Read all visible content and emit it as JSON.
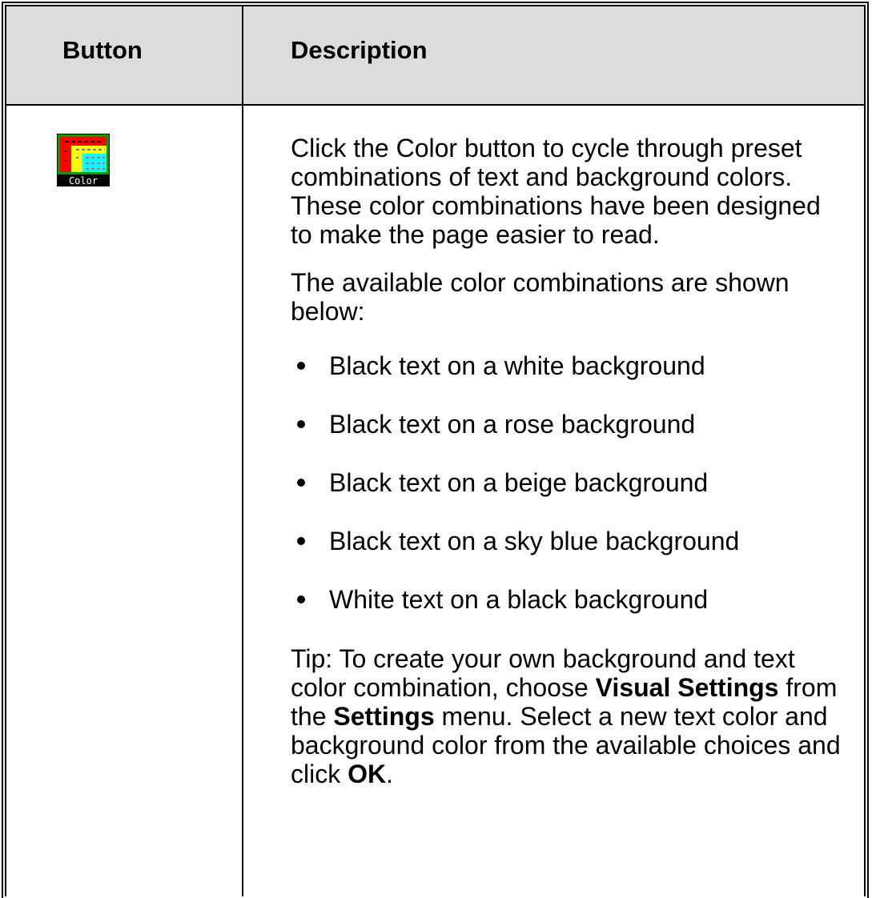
{
  "table": {
    "header": {
      "button_label": "Button",
      "description_label": "Description"
    },
    "row": {
      "icon": {
        "name": "color-icon",
        "caption": "Color",
        "colors": {
          "outer": "#00a000",
          "red": "#ff0000",
          "yellow": "#ffff00",
          "cyan": "#00ffff",
          "caption_bg": "#000000",
          "caption_fg": "#ffffff"
        }
      },
      "paragraph1": "Click the Color button to cycle through preset combinations of text and background colors. These color combinations have been designed to make the page easier to read.",
      "paragraph2": "The available color combinations are shown below:",
      "bullets": [
        "Black text on a white background",
        "Black text on a rose background",
        "Black text on a beige background",
        "Black text on a sky blue background",
        "White text on a black background"
      ],
      "tip": {
        "t1": "Tip: To create your own background and text color combination, choose ",
        "b1": "Visual Settings",
        "t2": " from the ",
        "b2": "Settings",
        "t3": " menu. Select a new text color and background color from the available choices and click ",
        "b3": "OK",
        "t4": "."
      }
    }
  },
  "colors": {
    "header_bg": "#dcdcdc",
    "border": "#000000",
    "page_bg": "#ffffff"
  }
}
